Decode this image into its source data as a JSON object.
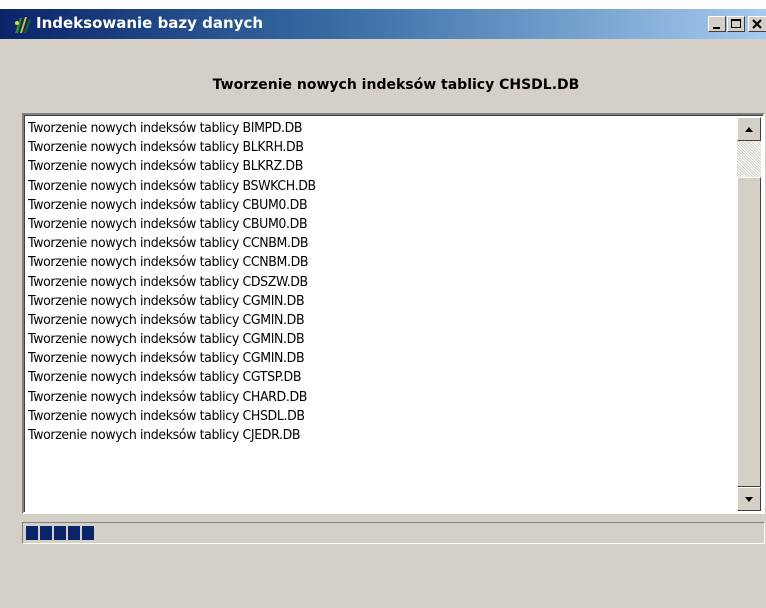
{
  "window": {
    "title": "Indeksowanie bazy danych",
    "icon": "database-index-icon",
    "controls": {
      "minimize": "minimize-icon",
      "maximize": "maximize-icon",
      "close": "close-icon"
    }
  },
  "header": {
    "current_task": "Tworzenie nowych indeksów tablicy CHSDL.DB"
  },
  "log": {
    "items": [
      "Tworzenie nowych indeksów tablicy BIMPD.DB",
      "Tworzenie nowych indeksów tablicy BLKRH.DB",
      "Tworzenie nowych indeksów tablicy BLKRZ.DB",
      "Tworzenie nowych indeksów tablicy BSWKCH.DB",
      "Tworzenie nowych indeksów tablicy CBUM0.DB",
      "Tworzenie nowych indeksów tablicy CBUM0.DB",
      "Tworzenie nowych indeksów tablicy CCNBM.DB",
      "Tworzenie nowych indeksów tablicy CCNBM.DB",
      "Tworzenie nowych indeksów tablicy CDSZW.DB",
      "Tworzenie nowych indeksów tablicy CGMIN.DB",
      "Tworzenie nowych indeksów tablicy CGMIN.DB",
      "Tworzenie nowych indeksów tablicy CGMIN.DB",
      "Tworzenie nowych indeksów tablicy CGMIN.DB",
      "Tworzenie nowych indeksów tablicy CGTSP.DB",
      "Tworzenie nowych indeksów tablicy CHARD.DB",
      "Tworzenie nowych indeksów tablicy CHSDL.DB",
      "Tworzenie nowych indeksów tablicy CJEDR.DB"
    ]
  },
  "progress": {
    "fraction": 0.1,
    "color": "#0a246a"
  },
  "colors": {
    "titlebar_start": "#0a246a",
    "titlebar_end": "#a6caf0",
    "face": "#d4d0c8"
  }
}
